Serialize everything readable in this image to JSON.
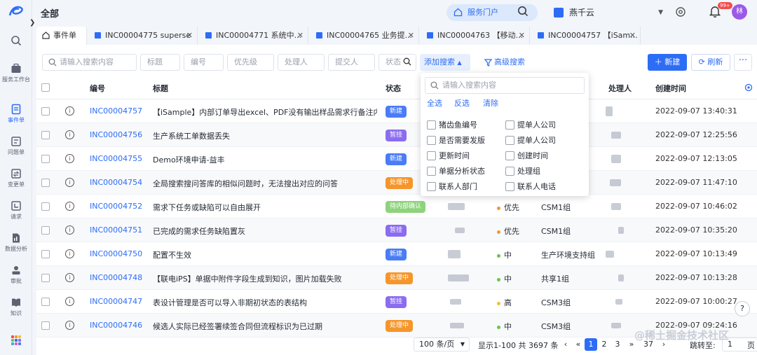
{
  "app": {
    "page_title": "全部",
    "portal_label": "服务门户",
    "org_name": "燕千云",
    "notif_badge": "99+",
    "avatar_text": "林"
  },
  "sidebar": [
    {
      "label": "服务工作台",
      "icon": "briefcase-icon"
    },
    {
      "label": "事件单",
      "icon": "document-icon",
      "active": true
    },
    {
      "label": "问题单",
      "icon": "problem-icon"
    },
    {
      "label": "变更单",
      "icon": "change-icon"
    },
    {
      "label": "请求",
      "icon": "request-icon"
    },
    {
      "label": "数据分析",
      "icon": "analytics-icon"
    },
    {
      "label": "审批",
      "icon": "approval-icon"
    },
    {
      "label": "知识",
      "icon": "book-icon"
    }
  ],
  "tabs": [
    {
      "label": "事件单"
    },
    {
      "label": "INC00004775 superse"
    },
    {
      "label": "INC00004771 系统中..."
    },
    {
      "label": "INC00004765 业务提..."
    },
    {
      "label": "INC00004763 【移动..."
    },
    {
      "label": "INC00004757 【iSam..."
    }
  ],
  "filters": {
    "search_placeholder": "请输入搜索内容",
    "title": "标题",
    "number": "编号",
    "priority": "优先级",
    "assignee": "处理人",
    "submitter": "提交人",
    "status": "状态",
    "add_search": "添加搜索",
    "advanced": "高级搜索",
    "new_btn": "新建",
    "refresh_btn": "刷新"
  },
  "table": {
    "headers": {
      "number": "编号",
      "title": "标题",
      "status": "状态",
      "assignee": "处理人",
      "created": "创建时间"
    },
    "rows": [
      {
        "no": "INC00004757",
        "title": "【iSample】内部订单导出excel、PDF没有输出样品需求行备注内容",
        "status": "新建",
        "status_color": "#4a7cf7",
        "priority": "",
        "pri_color": "",
        "group": "",
        "time": "2022-09-07 13:40:31"
      },
      {
        "no": "INC00004756",
        "title": "生产系统工单数据丢失",
        "status": "暂挂",
        "status_color": "#8b6cf0",
        "priority": "",
        "pri_color": "",
        "group": "",
        "time": "2022-09-07 12:25:56"
      },
      {
        "no": "INC00004755",
        "title": "Demo环境申请-益丰",
        "status": "新建",
        "status_color": "#4a7cf7",
        "priority": "",
        "pri_color": "",
        "group": "",
        "time": "2022-09-07 12:13:05"
      },
      {
        "no": "INC00004754",
        "title": "全局搜索搜问答库的相似问题时，无法搜出对应的问答",
        "status": "处理中",
        "status_color": "#f5962b",
        "priority": "",
        "pri_color": "",
        "group": "",
        "time": "2022-09-07 11:47:10"
      },
      {
        "no": "INC00004752",
        "title": "需求下任务或缺陷可以自由展开",
        "status": "待内部确认",
        "status_color": "#8fd37e",
        "priority": "优先",
        "pri_color": "#f5962b",
        "group": "CSM1组",
        "time": "2022-09-07 10:46:02"
      },
      {
        "no": "INC00004751",
        "title": "已完成的需求任务缺陷置灰",
        "status": "暂挂",
        "status_color": "#8b6cf0",
        "priority": "优先",
        "pri_color": "#f5962b",
        "group": "CSM1组",
        "time": "2022-09-07 10:35:20"
      },
      {
        "no": "INC00004750",
        "title": "配置不生效",
        "status": "新建",
        "status_color": "#4a7cf7",
        "priority": "中",
        "pri_color": "#6cc24a",
        "group": "生产环境支持组",
        "time": "2022-09-07 10:13:49"
      },
      {
        "no": "INC00004748",
        "title": "【联电iPS】单据中附件字段生成到知识，图片加载失败",
        "status": "处理中",
        "status_color": "#f5962b",
        "priority": "中",
        "pri_color": "#6cc24a",
        "group": "共享1组",
        "time": "2022-09-07 10:13:28"
      },
      {
        "no": "INC00004747",
        "title": "表设计管理是否可以导入非期初状态的表结构",
        "status": "暂挂",
        "status_color": "#8b6cf0",
        "priority": "高",
        "pri_color": "#f2c12e",
        "group": "CSM3组",
        "time": "2022-09-07 10:00:27"
      },
      {
        "no": "INC00004746",
        "title": "候选人实际已经签署续签合同但流程标识为已过期",
        "status": "处理中",
        "status_color": "#f5962b",
        "priority": "中",
        "pri_color": "#6cc24a",
        "group": "CSM3组",
        "time": "2022-09-07 09:24:16"
      }
    ]
  },
  "dropdown": {
    "search_placeholder": "请输入搜索内容",
    "select_all": "全选",
    "invert": "反选",
    "clear": "清除",
    "options": [
      "猪齿鱼编号",
      "提单人公司",
      "是否需要发版",
      "提单人公司",
      "更新时间",
      "创建时间",
      "单据分析状态",
      "处理组",
      "联系人部门",
      "联系人电话"
    ]
  },
  "pager": {
    "page_size": "100 条/页",
    "summary": "显示1-100 共 3697 条",
    "prev": "‹",
    "first": "«",
    "pages": [
      "1",
      "2",
      "3"
    ],
    "ellipsis": "»",
    "last_page": "37",
    "next": "›",
    "jump_label": "跳转至:",
    "jump_value": "1",
    "page_unit": "页"
  },
  "watermark": "@稀土掘金技术社区",
  "help_label": "?"
}
